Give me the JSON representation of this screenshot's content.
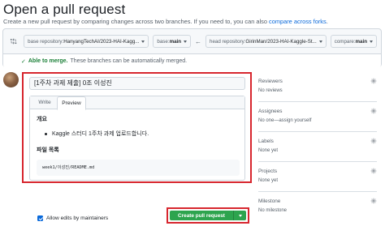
{
  "header": {
    "title": "Open a pull request",
    "subtitle_prefix": "Create a new pull request by comparing changes across two branches. If you need to, you can also ",
    "subtitle_link": "compare across forks",
    "subtitle_suffix": "."
  },
  "compare": {
    "base_repo_label": "base repository: ",
    "base_repo_value": "HanyangTechAI/2023-HAI-Kagg...",
    "base_label": "base: ",
    "base_value": "main",
    "head_repo_label": "head repository: ",
    "head_repo_value": "GirinMan/2023-HAI-Kaggle-St...",
    "compare_label": "compare: ",
    "compare_value": "main",
    "merge_status": "Able to merge.",
    "merge_detail": "These branches can be automatically merged."
  },
  "editor": {
    "title_value": "[1주차 과제 제출] 0조 이성진",
    "tabs": [
      {
        "label": "Write"
      },
      {
        "label": "Preview"
      }
    ],
    "preview": {
      "heading_overview": "개요",
      "bullet": "Kaggle 스터디 1주차 과제 업로드합니다.",
      "heading_files": "파일 목록",
      "code": "week1/이성진/README.md"
    }
  },
  "footer": {
    "allow_edits_label": "Allow edits by maintainers",
    "create_button": "Create pull request"
  },
  "sidebar": {
    "reviewers": {
      "title": "Reviewers",
      "value": "No reviews"
    },
    "assignees": {
      "title": "Assignees",
      "value": "No one—assign yourself"
    },
    "labels": {
      "title": "Labels",
      "value": "None yet"
    },
    "projects": {
      "title": "Projects",
      "value": "None yet"
    },
    "milestone": {
      "title": "Milestone",
      "value": "No milestone"
    }
  },
  "colors": {
    "highlight_border": "#d7262e",
    "primary_button": "#2da44e",
    "link": "#0969da",
    "success": "#1a7f37"
  }
}
